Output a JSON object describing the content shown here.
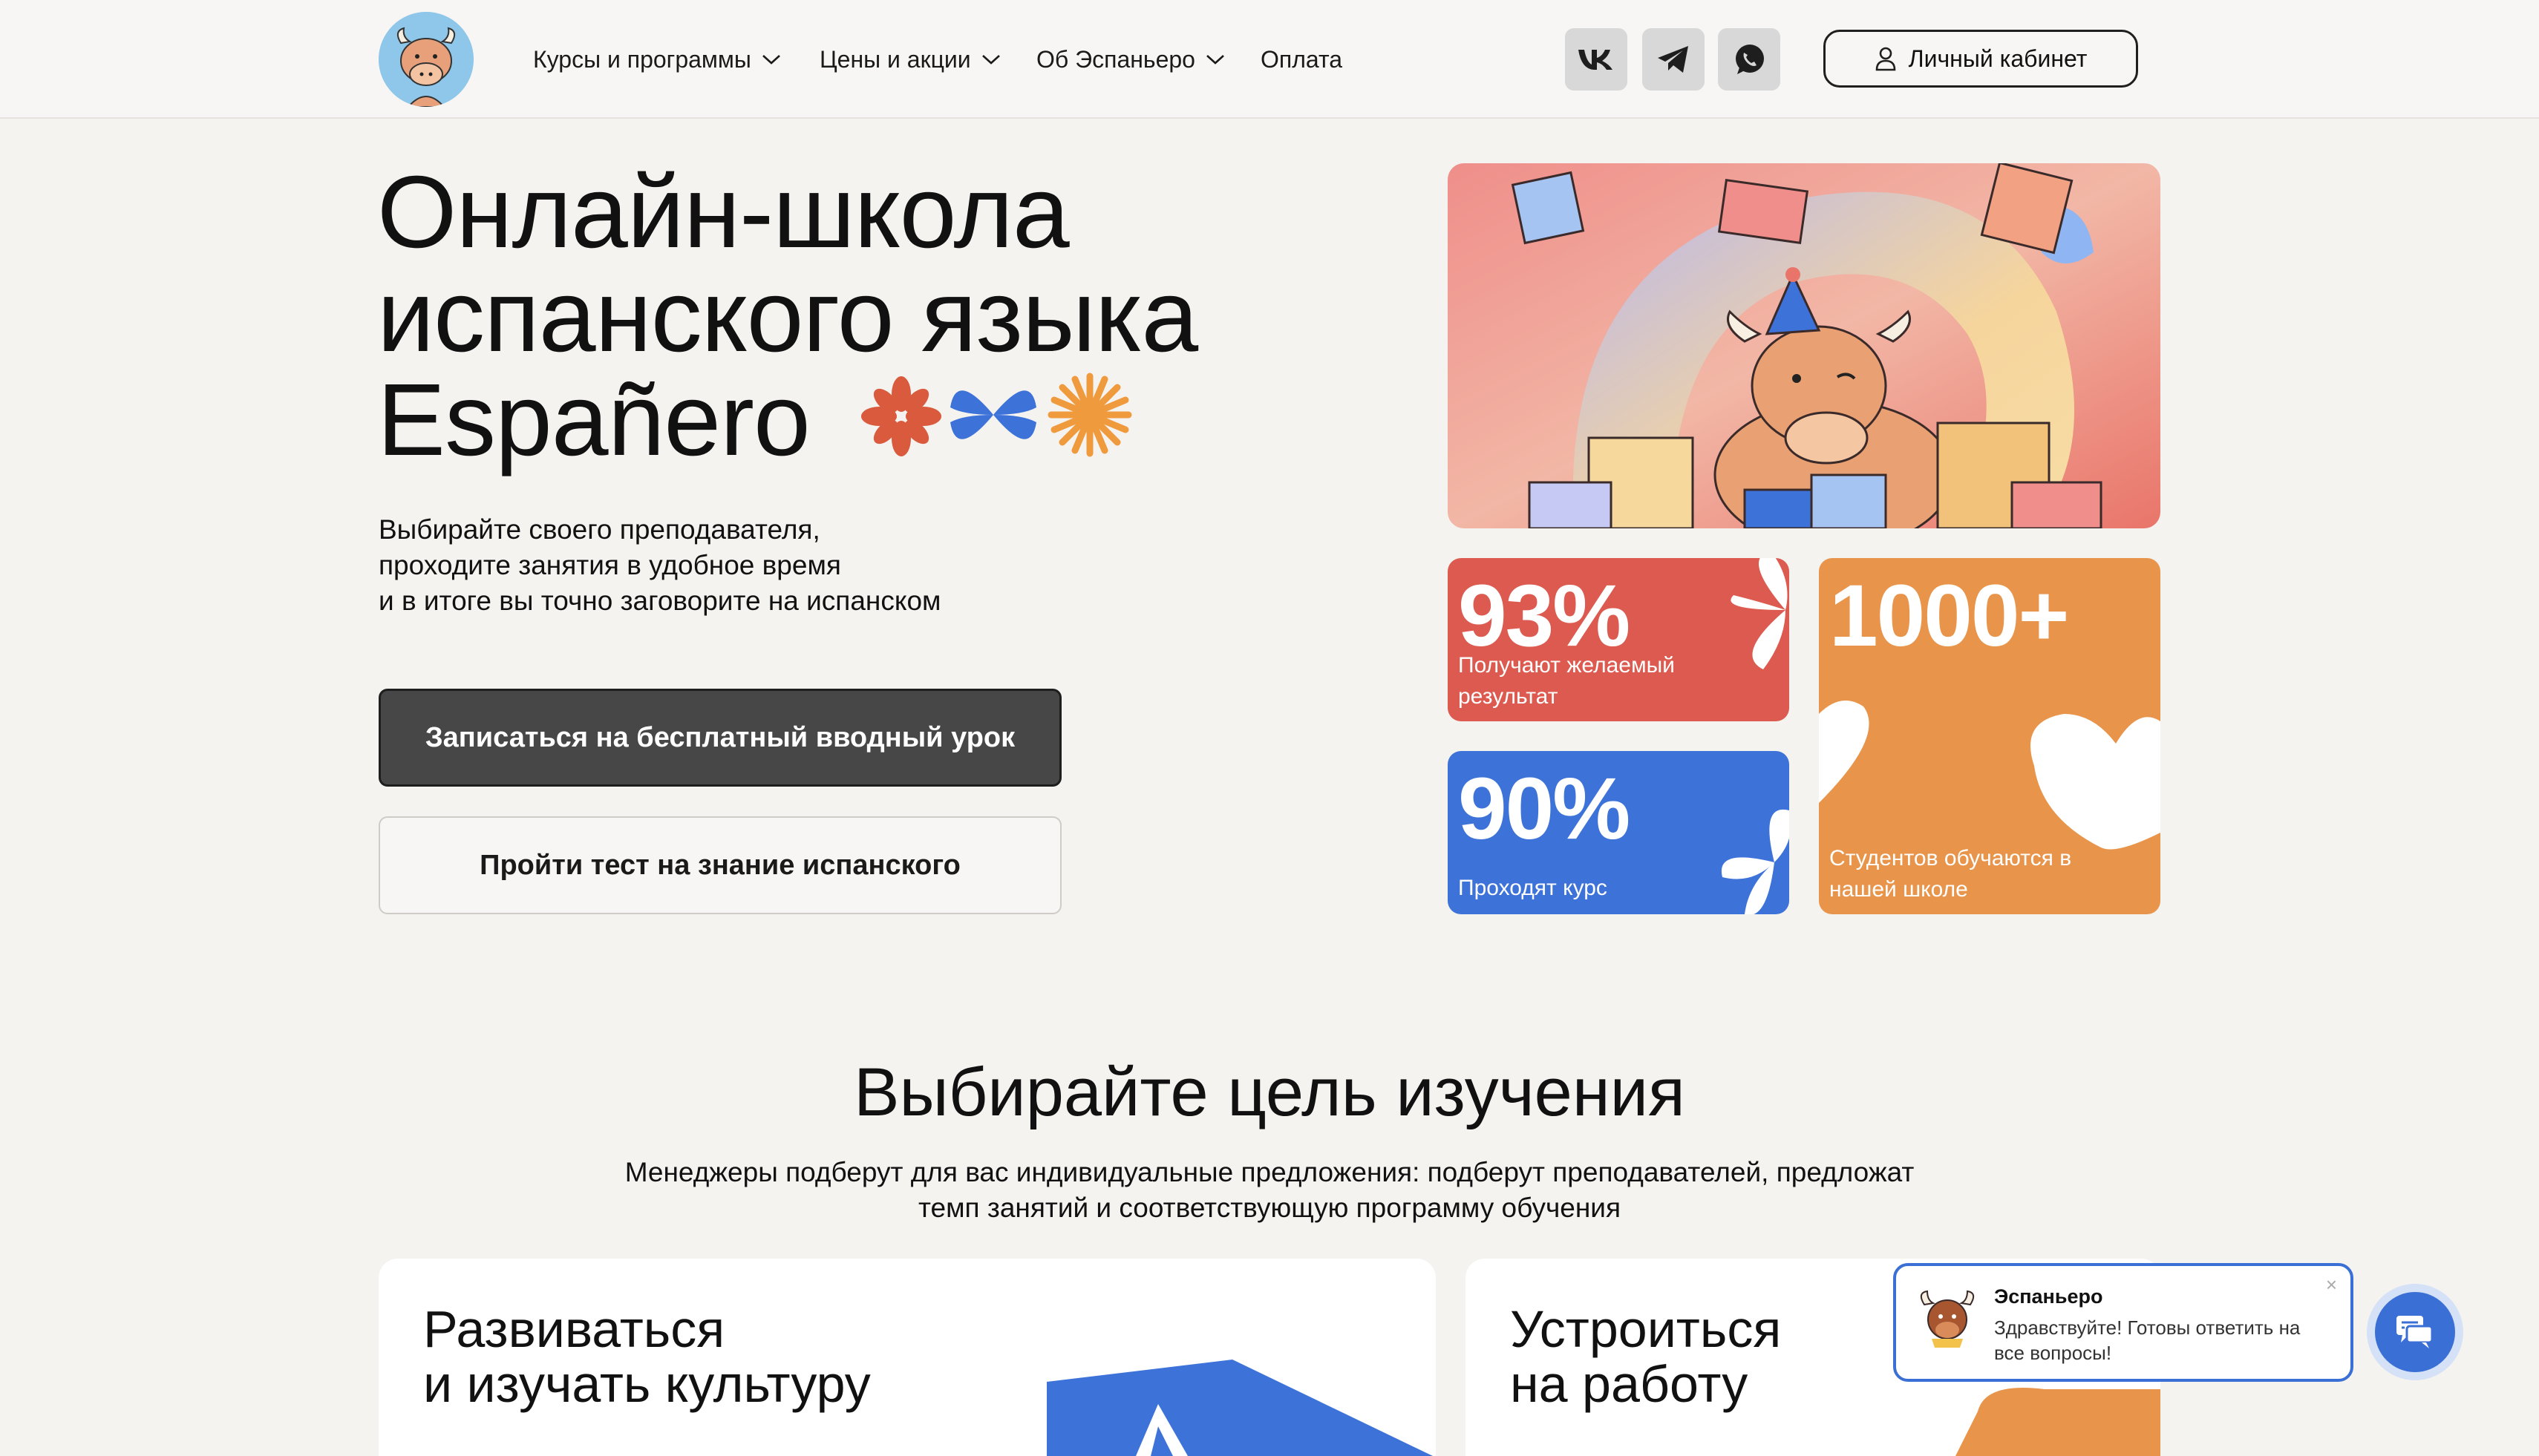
{
  "header": {
    "nav": [
      {
        "label": "Курсы и программы",
        "has_dropdown": true
      },
      {
        "label": "Цены и акции",
        "has_dropdown": true
      },
      {
        "label": "Об Эспаньеро",
        "has_dropdown": true
      },
      {
        "label": "Оплата",
        "has_dropdown": false
      }
    ],
    "social": [
      "vk-icon",
      "telegram-icon",
      "whatsapp-icon"
    ],
    "cabinet_label": "Личный кабинет"
  },
  "hero": {
    "title_lines": [
      "Онлайн-школа",
      "испанского языка",
      "Españero"
    ],
    "subtitle_lines": [
      "Выбирайте своего преподавателя,",
      "проходите занятия в удобное время",
      "и в итоге вы точно заговорите на испанском"
    ],
    "primary_button": "Записаться на бесплатный вводный урок",
    "secondary_button": "Пройти тест на знание испанского"
  },
  "stats": [
    {
      "value": "93%",
      "label_lines": [
        "Получают желаемый",
        "результат"
      ],
      "color": "#dc5a4f"
    },
    {
      "value": "90%",
      "label_lines": [
        "Проходят курс"
      ],
      "color": "#3d72d9"
    },
    {
      "value": "1000+",
      "label_lines": [
        "Студентов обучаются в",
        "нашей школе"
      ],
      "color": "#e8944a"
    }
  ],
  "goals": {
    "title": "Выбирайте цель изучения",
    "subtitle_lines": [
      "Менеджеры подберут для вас индивидуальные предложения: подберут преподавателей, предложат",
      "темп занятий и соответствующую программу обучения"
    ],
    "cards": [
      {
        "title_lines": [
          "Развиваться",
          "и изучать культуру"
        ]
      },
      {
        "title_lines": [
          "Устроиться",
          "на работу"
        ]
      }
    ]
  },
  "chat": {
    "name": "Эспаньеро",
    "message": "Здравствуйте! Готовы ответить на все вопросы!",
    "close": "×"
  },
  "colors": {
    "accent_blue": "#3d72d9",
    "accent_red": "#dc5a4f",
    "accent_orange": "#e8944a",
    "primary_button": "#474747"
  }
}
